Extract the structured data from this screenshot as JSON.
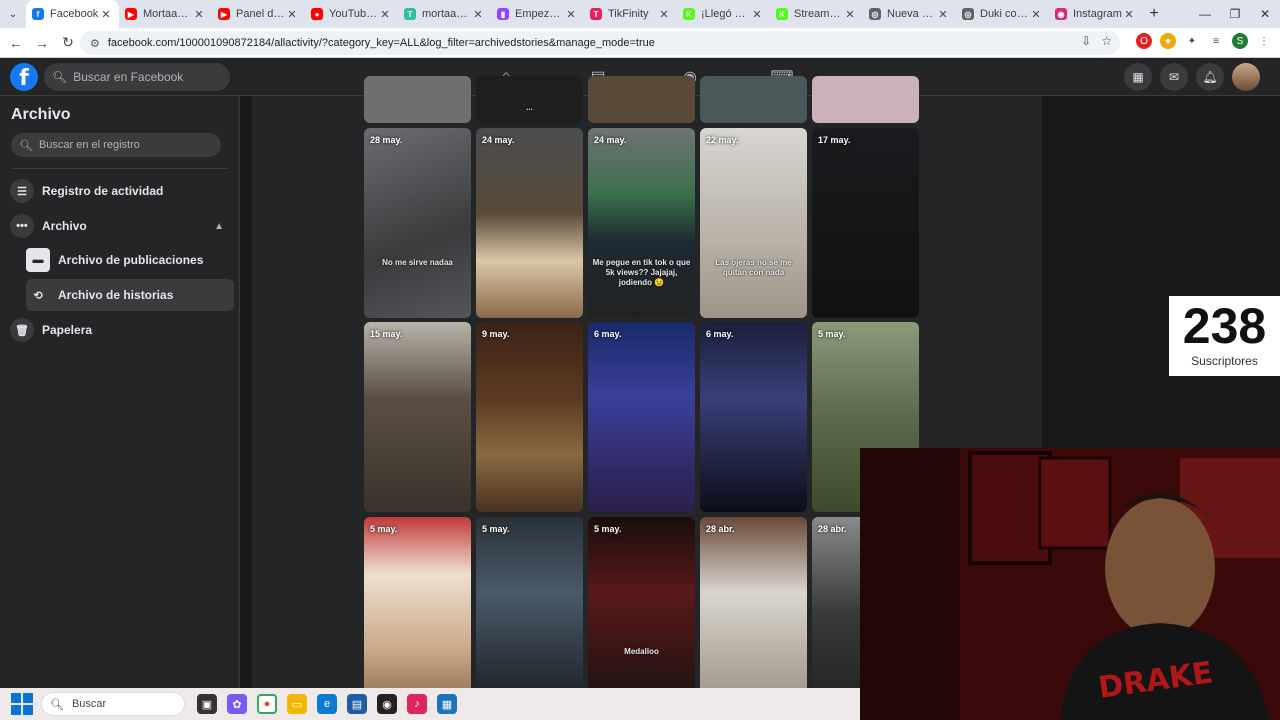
{
  "browser": {
    "tabs": [
      {
        "label": "Facebook",
        "color": "#1877f2",
        "glyph": "f"
      },
      {
        "label": "Mortaah - Yo",
        "color": "#ff0000",
        "glyph": "▶"
      },
      {
        "label": "Panel de con",
        "color": "#ff0000",
        "glyph": "▶"
      },
      {
        "label": "YouTube Mu",
        "color": "#ff0000",
        "glyph": "●"
      },
      {
        "label": "mortaah - St",
        "color": "#2fbfa0",
        "glyph": "T"
      },
      {
        "label": "Empezando",
        "color": "#9146ff",
        "glyph": "▮"
      },
      {
        "label": "TikFinity",
        "color": "#e0245e",
        "glyph": "T"
      },
      {
        "label": "¡Llegó KICK",
        "color": "#53fc18",
        "glyph": "K"
      },
      {
        "label": "Stream - Kic",
        "color": "#53fc18",
        "glyph": "K"
      },
      {
        "label": "Nueva pesta",
        "color": "#5f6368",
        "glyph": "◎"
      },
      {
        "label": "Duki concie",
        "color": "#5f6368",
        "glyph": "◎"
      },
      {
        "label": "Instagram",
        "color": "#d62976",
        "glyph": "◉"
      }
    ],
    "url": "facebook.com/100001090872184/allactivity/?category_key=ALL&log_filter=archivedstories&manage_mode=true"
  },
  "fb": {
    "search_placeholder": "Buscar en Facebook"
  },
  "sidebar": {
    "title": "Archivo",
    "search_placeholder": "Buscar en el registro",
    "items": [
      {
        "label": "Registro de actividad",
        "icon": "list-icon"
      },
      {
        "label": "Archivo",
        "icon": "more-icon"
      },
      {
        "label": "Archivo de publicaciones",
        "icon": "archive-box-icon"
      },
      {
        "label": "Archivo de historias",
        "icon": "history-icon"
      },
      {
        "label": "Papelera",
        "icon": "trash-icon"
      }
    ]
  },
  "stories": {
    "row1": [
      {
        "date": "28 may.",
        "caption": "No me sirve nadaa",
        "bg": "linear-gradient(160deg,#6b6d70,#3a3b3d 60%,#55565a)"
      },
      {
        "date": "24 may.",
        "caption": "",
        "bg": "linear-gradient(180deg,#4a4d50 0%,#5a4a3a 45%,#d9c7a8 70%,#8a6a4a 100%)"
      },
      {
        "date": "24 may.",
        "caption": "Me pegue en tik tok o que 5k views?? Jajajaj, jodiendo 😉",
        "bg": "linear-gradient(180deg,#6f7376 0%,#3b6f4a 35%,#1e2a33 60%,#222 100%)"
      },
      {
        "date": "22 may.",
        "caption": "Las ojeras no se me quitan con nada",
        "bg": "linear-gradient(180deg,#d8d6d2 0%,#bdb7ad 50%,#9e9588 100%)"
      },
      {
        "date": "17 may.",
        "caption": "",
        "bg": "linear-gradient(180deg,#1b1b1f,#111)"
      }
    ],
    "row2": [
      {
        "date": "15 may.",
        "caption": "",
        "bg": "linear-gradient(180deg,#b9b3a9 0%,#5a4f44 40%,#3a332b 100%)"
      },
      {
        "date": "9 may.",
        "caption": "",
        "bg": "linear-gradient(180deg,#3a2418 0%,#5c3a22 40%,#8a6a42 70%,#4a3222 100%)"
      },
      {
        "date": "6 may.",
        "caption": "",
        "bg": "linear-gradient(180deg,#1b2a6a 0%,#3b3f9a 40%,#2a1f4a 100%)"
      },
      {
        "date": "6 may.",
        "caption": "",
        "bg": "linear-gradient(180deg,#1a1f3a 0%,#3a3f7a 40%,#0c0e18 100%)"
      },
      {
        "date": "5 may.",
        "caption": "",
        "bg": "linear-gradient(180deg,#8a9a7a 0%,#5a6a4a 50%,#3a4a2a 100%)"
      }
    ],
    "row3": [
      {
        "date": "5 may.",
        "caption": "",
        "bg": "linear-gradient(180deg,#c13a3a 0%,#ede0d0 30%,#c9a98a 70%,#8a6a4a 100%)"
      },
      {
        "date": "5 may.",
        "caption": "",
        "bg": "linear-gradient(180deg,#2a3238 0%,#4a5a6a 40%,#1a1e22 100%)"
      },
      {
        "date": "5 may.",
        "caption": "Medalloo",
        "bg": "linear-gradient(180deg,#1a0e0e 0%,#5a1818 40%,#1a1212 100%)"
      },
      {
        "date": "28 abr.",
        "caption": "",
        "bg": "linear-gradient(180deg,#6a4a3a 0%,#dad6cf 40%,#9a8f80 100%)"
      },
      {
        "date": "28 abr.",
        "caption": "",
        "bg": "linear-gradient(180deg,#8a8a8a 0%,#3a3a3a 50%,#222 100%)"
      }
    ],
    "top_partial": [
      {
        "caption": "",
        "bg": "#6f6f72"
      },
      {
        "caption": "...",
        "bg": "#1f1f1f"
      },
      {
        "caption": "",
        "bg": "#5a4a3a"
      },
      {
        "caption": "",
        "bg": "#4a5a5a"
      },
      {
        "caption": "",
        "bg": "#c9b2b8"
      }
    ]
  },
  "overlay": {
    "subscribers_count": "238",
    "subscribers_label": "Suscriptores"
  },
  "taskbar": {
    "search_placeholder": "Buscar"
  }
}
